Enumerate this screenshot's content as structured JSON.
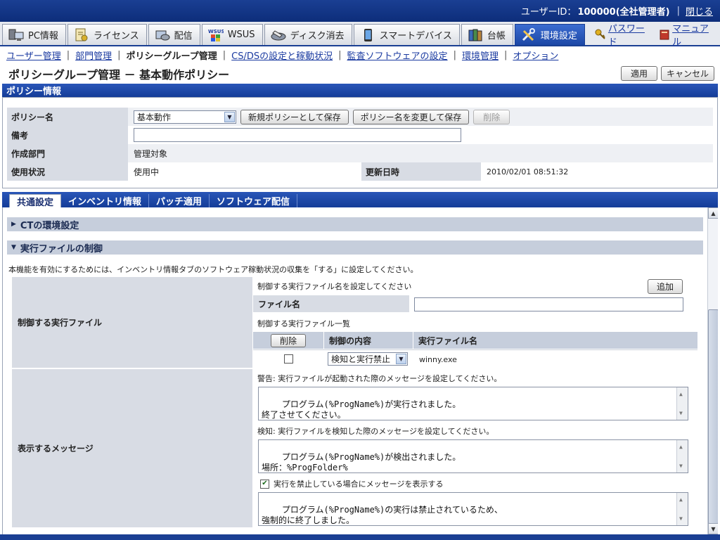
{
  "userbar": {
    "uid_label": "ユーザーID：",
    "uid_value": "100000(全社管理者)",
    "close": "閉じる"
  },
  "main_tabs": [
    {
      "label": "PC情報",
      "icon": "pc-icon"
    },
    {
      "label": "ライセンス",
      "icon": "license-icon"
    },
    {
      "label": "配信",
      "icon": "distribution-icon"
    },
    {
      "label": "WSUS",
      "icon": "wsus-icon"
    },
    {
      "label": "ディスク消去",
      "icon": "disk-erase-icon"
    },
    {
      "label": "スマートデバイス",
      "icon": "smart-device-icon"
    },
    {
      "label": "台帳",
      "icon": "ledger-icon"
    },
    {
      "label": "環境設定",
      "icon": "tools-icon"
    }
  ],
  "right_links": {
    "password": "パスワード",
    "manual": "マニュアル"
  },
  "subnav": {
    "user_mgmt": "ユーザー管理",
    "dept_mgmt": "部門管理",
    "policy_group": "ポリシーグループ管理",
    "csds": "CS/DSの設定と稼動状況",
    "audit": "監査ソフトウェアの設定",
    "env_mgmt": "環境管理",
    "option": "オプション"
  },
  "page": {
    "title": "ポリシーグループ管理 － 基本動作ポリシー",
    "apply": "適用",
    "cancel": "キャンセル"
  },
  "policy_info": {
    "header": "ポリシー情報",
    "name_label": "ポリシー名",
    "name_value": "基本動作",
    "save_new": "新規ポリシーとして保存",
    "rename_save": "ポリシー名を変更して保存",
    "delete": "削除",
    "note_label": "備考",
    "note_value": "",
    "dept_label": "作成部門",
    "dept_value": "管理対象",
    "status_label": "使用状況",
    "status_value": "使用中",
    "updated_label": "更新日時",
    "updated_value": "2010/02/01 08:51:32"
  },
  "content_tabs": [
    "共通設定",
    "インベントリ情報",
    "パッチ適用",
    "ソフトウェア配信"
  ],
  "sections": {
    "ct_env": "CTの環境設定",
    "exec_control": "実行ファイルの制御",
    "note": "本機能を有効にするためには、インベントリ情報タブのソフトウェア稼動状況の収集を「する」に設定してください。"
  },
  "exec": {
    "left_label": "制御する実行ファイル",
    "set_prompt": "制御する実行ファイル名を設定してください",
    "add": "追加",
    "file_name_label": "ファイル名",
    "file_name_value": "",
    "list_title": "制御する実行ファイル一覧",
    "col_delete": "削除",
    "col_control": "制御の内容",
    "col_exe": "実行ファイル名",
    "row_control": "検知と実行禁止",
    "row_exe": "winny.exe"
  },
  "messages": {
    "left_label": "表示するメッセージ",
    "warn_desc": "警告:  実行ファイルが起動された際のメッセージを設定してください。",
    "warn_text": "プログラム(%ProgName%)が実行されました。\n終了させてください。",
    "detect_desc": "検知:  実行ファイルを検知した際のメッセージを設定してください。",
    "detect_text": "プログラム(%ProgName%)が検出されました。\n場所：%ProgFolder%",
    "block_check": "実行を禁止している場合にメッセージを表示する",
    "block_text": "プログラム(%ProgName%)の実行は禁止されているため、\n強制的に終了しました。"
  }
}
